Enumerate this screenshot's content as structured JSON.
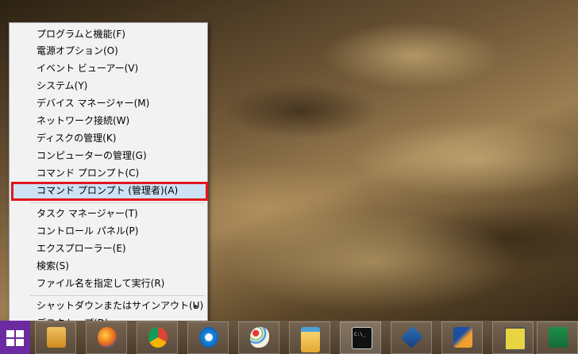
{
  "menu": {
    "items": [
      {
        "label": "プログラムと機能(F)"
      },
      {
        "label": "電源オプション(O)"
      },
      {
        "label": "イベント ビューアー(V)"
      },
      {
        "label": "システム(Y)"
      },
      {
        "label": "デバイス マネージャー(M)"
      },
      {
        "label": "ネットワーク接続(W)"
      },
      {
        "label": "ディスクの管理(K)"
      },
      {
        "label": "コンピューターの管理(G)"
      },
      {
        "label": "コマンド プロンプト(C)"
      },
      {
        "label": "コマンド プロンプト (管理者)(A)"
      },
      {
        "label": "タスク マネージャー(T)"
      },
      {
        "label": "コントロール パネル(P)"
      },
      {
        "label": "エクスプローラー(E)"
      },
      {
        "label": "検索(S)"
      },
      {
        "label": "ファイル名を指定して実行(R)"
      },
      {
        "label": "シャットダウンまたはサインアウト(U)"
      },
      {
        "label": "デスクトップ(D)"
      }
    ],
    "selected_index": 9,
    "submenu_arrow": "▶"
  },
  "taskbar": {
    "pinned": [
      {
        "icon": "outlook-icon"
      },
      {
        "icon": "firefox-icon"
      },
      {
        "icon": "chrome-icon"
      },
      {
        "icon": "internet-explorer-icon"
      },
      {
        "icon": "paint-icon"
      },
      {
        "icon": "file-explorer-icon"
      },
      {
        "icon": "command-prompt-icon"
      },
      {
        "icon": "virtualbox-icon"
      },
      {
        "icon": "pen-tool-icon"
      },
      {
        "icon": "text-editor-icon"
      },
      {
        "icon": "excel-icon"
      }
    ],
    "terminal_glyph": "C:\\_"
  },
  "colors": {
    "highlight_border": "#e2161c",
    "menu_background": "#f2f2f2",
    "start_button": "#6a2aa0"
  }
}
